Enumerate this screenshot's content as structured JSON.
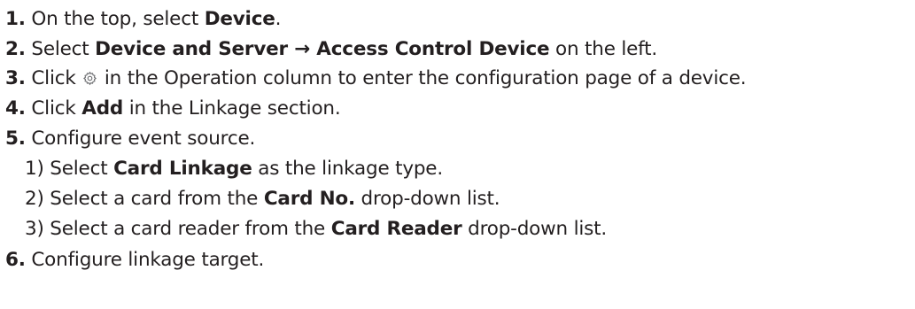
{
  "steps": [
    {
      "num": "1.",
      "t1": "On the top, select ",
      "b1": "Device",
      "t2": "."
    },
    {
      "num": "2.",
      "t1": "Select ",
      "b1": "Device and Server → Access Control Device",
      "t2": " on the left."
    },
    {
      "num": "3.",
      "t1": "Click ",
      "icon": "gear-icon",
      "t2": " in the Operation column to enter the configuration page of a device."
    },
    {
      "num": "4.",
      "t1": "Click ",
      "b1": "Add",
      "t2": " in the Linkage section."
    },
    {
      "num": "5.",
      "t1": "Configure event source.",
      "substeps": [
        {
          "num": "1)",
          "t1": " Select ",
          "b1": "Card Linkage",
          "t2": " as the linkage type."
        },
        {
          "num": "2)",
          "t1": " Select a card from the ",
          "b1": "Card No.",
          "t2": " drop-down list."
        },
        {
          "num": "3)",
          "t1": " Select a card reader from the ",
          "b1": "Card Reader",
          "t2": " drop-down list."
        }
      ]
    },
    {
      "num": "6.",
      "t1": "Configure linkage target."
    }
  ]
}
